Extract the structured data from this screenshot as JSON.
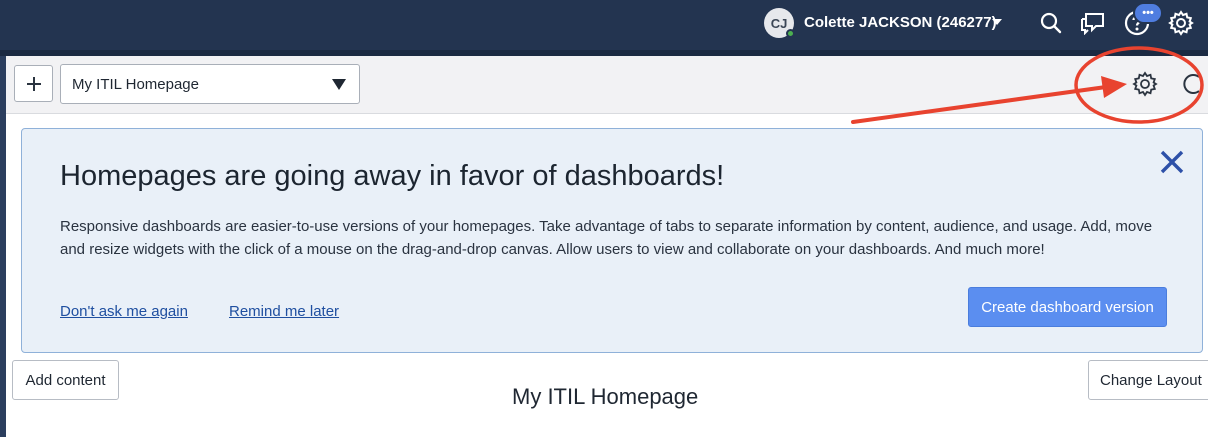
{
  "header": {
    "avatar_initials": "CJ",
    "user_name": "Colette JACKSON (246277)",
    "chat_badge": "•••",
    "icons": [
      "search-icon",
      "chat-icon",
      "help-icon",
      "gear-icon"
    ],
    "bg_color": "#233450"
  },
  "toolbar": {
    "add_icon": "plus-icon",
    "page_select_value": "My ITIL Homepage",
    "gear_icon": "gear-icon",
    "refresh_icon": "refresh-icon"
  },
  "banner": {
    "title": "Homepages are going away in favor of dashboards!",
    "body": "Responsive dashboards are easier-to-use versions of your homepages. Take advantage of tabs to separate information by content, audience, and usage. Add, move and resize widgets with the click of a mouse on the drag-and-drop canvas. Allow users to view and collaborate on your dashboards. And much more!",
    "dont_ask_link": "Don't ask me again",
    "remind_link": "Remind me later",
    "create_button": "Create dashboard version",
    "close_icon": "close-icon",
    "accent_color": "#5b8ef0"
  },
  "content": {
    "add_content_button": "Add content",
    "page_title": "My ITIL Homepage",
    "change_layout_button": "Change Layout"
  },
  "annotation": {
    "color": "#e8432f",
    "shapes": [
      "arrow",
      "circle"
    ]
  }
}
